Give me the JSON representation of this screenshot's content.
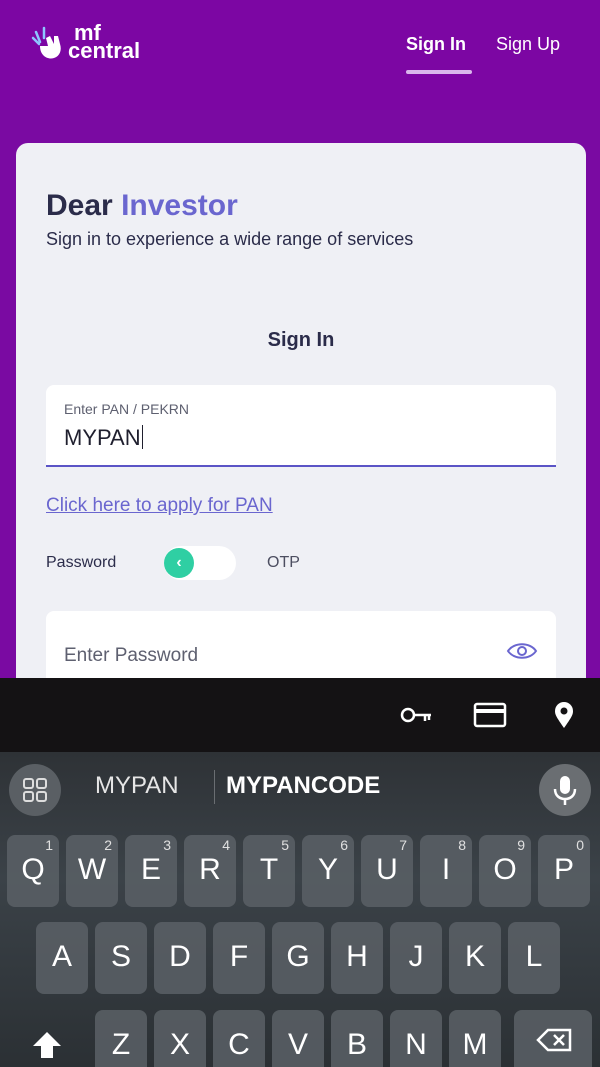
{
  "header": {
    "logo_line1": "mf",
    "logo_line2": "central",
    "nav": {
      "signin": "Sign In",
      "signup": "Sign Up"
    }
  },
  "card": {
    "greeting_part1": "Dear",
    "greeting_part2": "Investor",
    "subtitle": "Sign in to experience a wide range of services",
    "heading": "Sign In",
    "pan_field": {
      "label": "Enter PAN / PEKRN",
      "value": "MYPAN"
    },
    "apply_link": "Click here to apply for PAN",
    "toggle": {
      "left_label": "Password",
      "right_label": "OTP",
      "knob_icon": "chevron-left-icon"
    },
    "password_field": {
      "placeholder": "Enter Password",
      "icon": "eye-icon"
    }
  },
  "keyboard": {
    "toolbar_icons": [
      "key-icon",
      "card-icon",
      "location-pin-icon"
    ],
    "suggestions": [
      "MYPAN",
      "MYPANCODE"
    ],
    "row1": [
      {
        "key": "Q",
        "num": "1"
      },
      {
        "key": "W",
        "num": "2"
      },
      {
        "key": "E",
        "num": "3"
      },
      {
        "key": "R",
        "num": "4"
      },
      {
        "key": "T",
        "num": "5"
      },
      {
        "key": "Y",
        "num": "6"
      },
      {
        "key": "U",
        "num": "7"
      },
      {
        "key": "I",
        "num": "8"
      },
      {
        "key": "O",
        "num": "9"
      },
      {
        "key": "P",
        "num": "0"
      }
    ],
    "row2": [
      "A",
      "S",
      "D",
      "F",
      "G",
      "H",
      "J",
      "K",
      "L"
    ],
    "row3": [
      "Z",
      "X",
      "C",
      "V",
      "B",
      "N",
      "M"
    ]
  },
  "colors": {
    "brand_purple": "#7c06a3",
    "accent": "#6a66cf",
    "toggle_knob": "#2fcfa3"
  }
}
